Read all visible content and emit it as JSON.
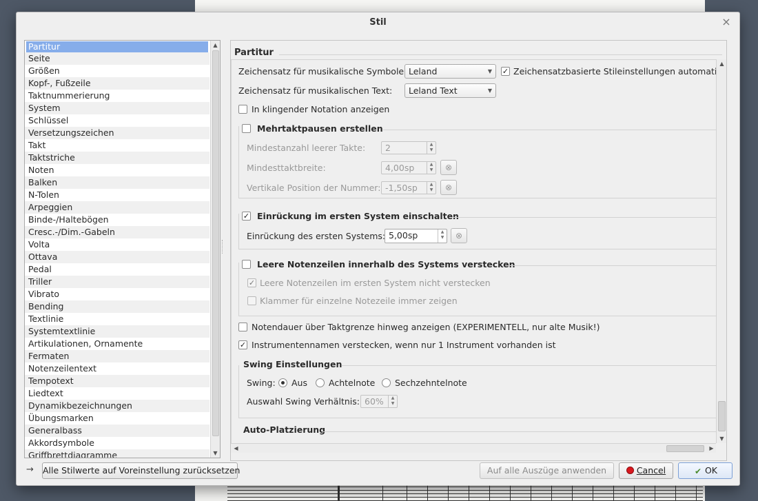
{
  "dialog": {
    "title": "Stil",
    "close_symbol": "×"
  },
  "sidebar": {
    "items": [
      "Partitur",
      "Seite",
      "Größen",
      "Kopf-, Fußzeile",
      "Taktnummerierung",
      "System",
      "Schlüssel",
      "Versetzungszeichen",
      "Takt",
      "Taktstriche",
      "Noten",
      "Balken",
      "N-Tolen",
      "Arpeggien",
      "Binde-/Haltebögen",
      "Cresc.-/Dim.-Gabeln",
      "Volta",
      "Ottava",
      "Pedal",
      "Triller",
      "Vibrato",
      "Bending",
      "Textlinie",
      "Systemtextlinie",
      "Artikulationen, Ornamente",
      "Fermaten",
      "Notenzeilentext",
      "Tempotext",
      "Liedtext",
      "Dynamikbezeichnungen",
      "Übungsmarken",
      "Generalbass",
      "Akkordsymbole",
      "Griffbrettdiagramme"
    ],
    "selected": "Partitur"
  },
  "panel": {
    "heading": "Partitur",
    "font_symbols_label": "Zeichensatz für musikalische Symbole:",
    "font_symbols_value": "Leland",
    "font_based_style_label": "Zeichensatzbasierte Stileinstellungen automatisch",
    "font_based_style_checked": "✓",
    "font_text_label": "Zeichensatz für musikalischen Text:",
    "font_text_value": "Leland Text",
    "concert_pitch_label": "In klingender Notation anzeigen",
    "mmrest": {
      "title": "Mehrtaktpausen erstellen",
      "min_empty_label": "Mindestanzahl leerer Takte:",
      "min_empty_value": "2",
      "min_width_label": "Mindesttaktbreite:",
      "min_width_value": "4,00sp",
      "vpos_label": "Vertikale Position der Nummer:",
      "vpos_value": "-1,50sp"
    },
    "indent": {
      "title": "Einrückung im ersten System einschalten",
      "checked": "✓",
      "label": "Einrückung des ersten Systems:",
      "value": "5,00sp"
    },
    "hide_empty": {
      "title": "Leere Notenzeilen innerhalb des Systems verstecken",
      "first_system_label": "Leere Notenzeilen im ersten System nicht verstecken",
      "first_system_checked": "✓",
      "bracket_label": "Klammer für einzelne Notezeile immer zeigen"
    },
    "note_duration_label": "Notendauer über Taktgrenze hinweg anzeigen (EXPERIMENTELL, nur alte Musik!)",
    "hide_instrument_label": "Instrumentennamen verstecken, wenn nur 1 Instrument vorhanden ist",
    "hide_instrument_checked": "✓",
    "swing": {
      "title": "Swing Einstellungen",
      "label": "Swing:",
      "options": [
        "Aus",
        "Achtelnote",
        "Sechzehntelnote"
      ],
      "selected": "Aus",
      "ratio_label": "Auswahl Swing Verhältnis:",
      "ratio_value": "60%"
    },
    "auto_placement_title": "Auto-Platzierung"
  },
  "footer": {
    "reset_all_label": "Alle Stilwerte auf Voreinstellung zurücksetzen",
    "apply_parts_label": "Auf alle Auszüge anwenden",
    "cancel_label": "Cancel",
    "ok_label": "OK"
  },
  "icons": {
    "arrow_right": "→",
    "reset": "⊗",
    "dropdown": "▼",
    "scroll_up": "▲",
    "scroll_down": "▼",
    "scroll_left": "◀",
    "scroll_right": "▶"
  },
  "colors": {
    "selection": "#86adea",
    "cancel_icon": "#d9181e",
    "ok_icon": "#4a8a2e"
  }
}
